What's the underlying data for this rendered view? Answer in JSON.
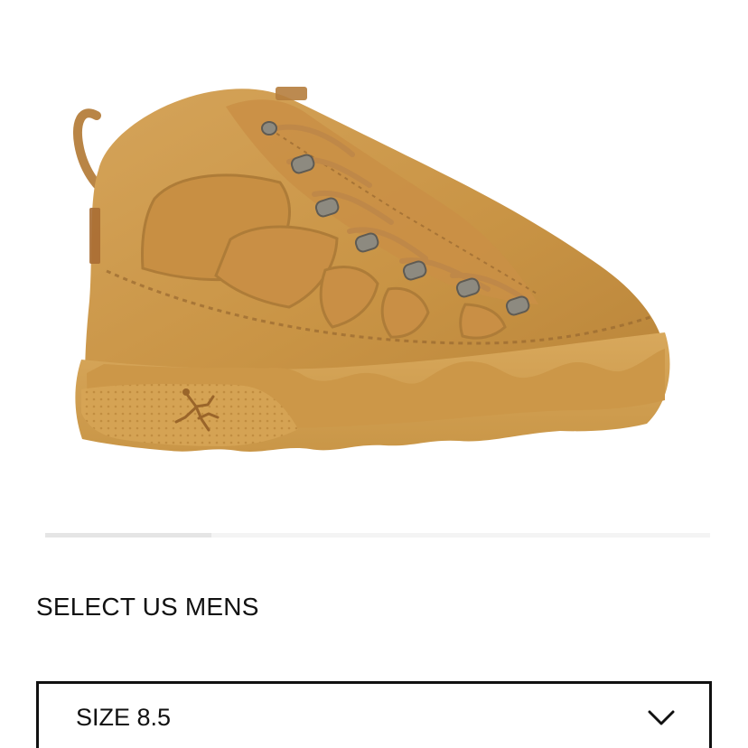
{
  "product": {
    "image_alt": "wheat-colored high-top boot",
    "image_icon": "boot-product-image",
    "colors": {
      "leather": "#c8964a",
      "sole": "#d8a457",
      "eyelet": "#8d8a80"
    }
  },
  "carousel": {
    "current_fraction": 0.25
  },
  "size_selector": {
    "heading": "SELECT US MENS",
    "selected_value": "SIZE 8.5",
    "chevron_icon": "chevron-down-icon"
  }
}
